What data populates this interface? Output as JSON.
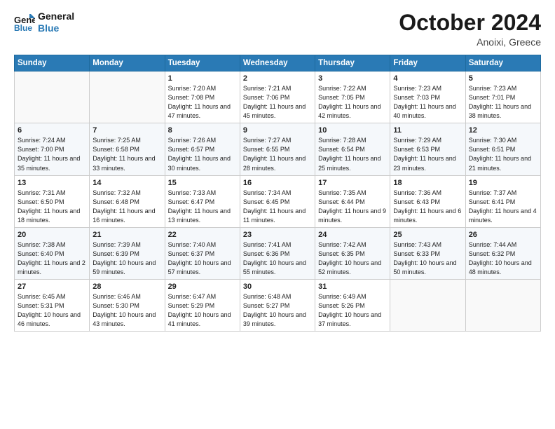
{
  "header": {
    "logo_line1": "General",
    "logo_line2": "Blue",
    "month_title": "October 2024",
    "location": "Anoixi, Greece"
  },
  "days_of_week": [
    "Sunday",
    "Monday",
    "Tuesday",
    "Wednesday",
    "Thursday",
    "Friday",
    "Saturday"
  ],
  "weeks": [
    [
      {
        "day": "",
        "info": ""
      },
      {
        "day": "",
        "info": ""
      },
      {
        "day": "1",
        "info": "Sunrise: 7:20 AM\nSunset: 7:08 PM\nDaylight: 11 hours and 47 minutes."
      },
      {
        "day": "2",
        "info": "Sunrise: 7:21 AM\nSunset: 7:06 PM\nDaylight: 11 hours and 45 minutes."
      },
      {
        "day": "3",
        "info": "Sunrise: 7:22 AM\nSunset: 7:05 PM\nDaylight: 11 hours and 42 minutes."
      },
      {
        "day": "4",
        "info": "Sunrise: 7:23 AM\nSunset: 7:03 PM\nDaylight: 11 hours and 40 minutes."
      },
      {
        "day": "5",
        "info": "Sunrise: 7:23 AM\nSunset: 7:01 PM\nDaylight: 11 hours and 38 minutes."
      }
    ],
    [
      {
        "day": "6",
        "info": "Sunrise: 7:24 AM\nSunset: 7:00 PM\nDaylight: 11 hours and 35 minutes."
      },
      {
        "day": "7",
        "info": "Sunrise: 7:25 AM\nSunset: 6:58 PM\nDaylight: 11 hours and 33 minutes."
      },
      {
        "day": "8",
        "info": "Sunrise: 7:26 AM\nSunset: 6:57 PM\nDaylight: 11 hours and 30 minutes."
      },
      {
        "day": "9",
        "info": "Sunrise: 7:27 AM\nSunset: 6:55 PM\nDaylight: 11 hours and 28 minutes."
      },
      {
        "day": "10",
        "info": "Sunrise: 7:28 AM\nSunset: 6:54 PM\nDaylight: 11 hours and 25 minutes."
      },
      {
        "day": "11",
        "info": "Sunrise: 7:29 AM\nSunset: 6:53 PM\nDaylight: 11 hours and 23 minutes."
      },
      {
        "day": "12",
        "info": "Sunrise: 7:30 AM\nSunset: 6:51 PM\nDaylight: 11 hours and 21 minutes."
      }
    ],
    [
      {
        "day": "13",
        "info": "Sunrise: 7:31 AM\nSunset: 6:50 PM\nDaylight: 11 hours and 18 minutes."
      },
      {
        "day": "14",
        "info": "Sunrise: 7:32 AM\nSunset: 6:48 PM\nDaylight: 11 hours and 16 minutes."
      },
      {
        "day": "15",
        "info": "Sunrise: 7:33 AM\nSunset: 6:47 PM\nDaylight: 11 hours and 13 minutes."
      },
      {
        "day": "16",
        "info": "Sunrise: 7:34 AM\nSunset: 6:45 PM\nDaylight: 11 hours and 11 minutes."
      },
      {
        "day": "17",
        "info": "Sunrise: 7:35 AM\nSunset: 6:44 PM\nDaylight: 11 hours and 9 minutes."
      },
      {
        "day": "18",
        "info": "Sunrise: 7:36 AM\nSunset: 6:43 PM\nDaylight: 11 hours and 6 minutes."
      },
      {
        "day": "19",
        "info": "Sunrise: 7:37 AM\nSunset: 6:41 PM\nDaylight: 11 hours and 4 minutes."
      }
    ],
    [
      {
        "day": "20",
        "info": "Sunrise: 7:38 AM\nSunset: 6:40 PM\nDaylight: 11 hours and 2 minutes."
      },
      {
        "day": "21",
        "info": "Sunrise: 7:39 AM\nSunset: 6:39 PM\nDaylight: 10 hours and 59 minutes."
      },
      {
        "day": "22",
        "info": "Sunrise: 7:40 AM\nSunset: 6:37 PM\nDaylight: 10 hours and 57 minutes."
      },
      {
        "day": "23",
        "info": "Sunrise: 7:41 AM\nSunset: 6:36 PM\nDaylight: 10 hours and 55 minutes."
      },
      {
        "day": "24",
        "info": "Sunrise: 7:42 AM\nSunset: 6:35 PM\nDaylight: 10 hours and 52 minutes."
      },
      {
        "day": "25",
        "info": "Sunrise: 7:43 AM\nSunset: 6:33 PM\nDaylight: 10 hours and 50 minutes."
      },
      {
        "day": "26",
        "info": "Sunrise: 7:44 AM\nSunset: 6:32 PM\nDaylight: 10 hours and 48 minutes."
      }
    ],
    [
      {
        "day": "27",
        "info": "Sunrise: 6:45 AM\nSunset: 5:31 PM\nDaylight: 10 hours and 46 minutes."
      },
      {
        "day": "28",
        "info": "Sunrise: 6:46 AM\nSunset: 5:30 PM\nDaylight: 10 hours and 43 minutes."
      },
      {
        "day": "29",
        "info": "Sunrise: 6:47 AM\nSunset: 5:29 PM\nDaylight: 10 hours and 41 minutes."
      },
      {
        "day": "30",
        "info": "Sunrise: 6:48 AM\nSunset: 5:27 PM\nDaylight: 10 hours and 39 minutes."
      },
      {
        "day": "31",
        "info": "Sunrise: 6:49 AM\nSunset: 5:26 PM\nDaylight: 10 hours and 37 minutes."
      },
      {
        "day": "",
        "info": ""
      },
      {
        "day": "",
        "info": ""
      }
    ]
  ]
}
